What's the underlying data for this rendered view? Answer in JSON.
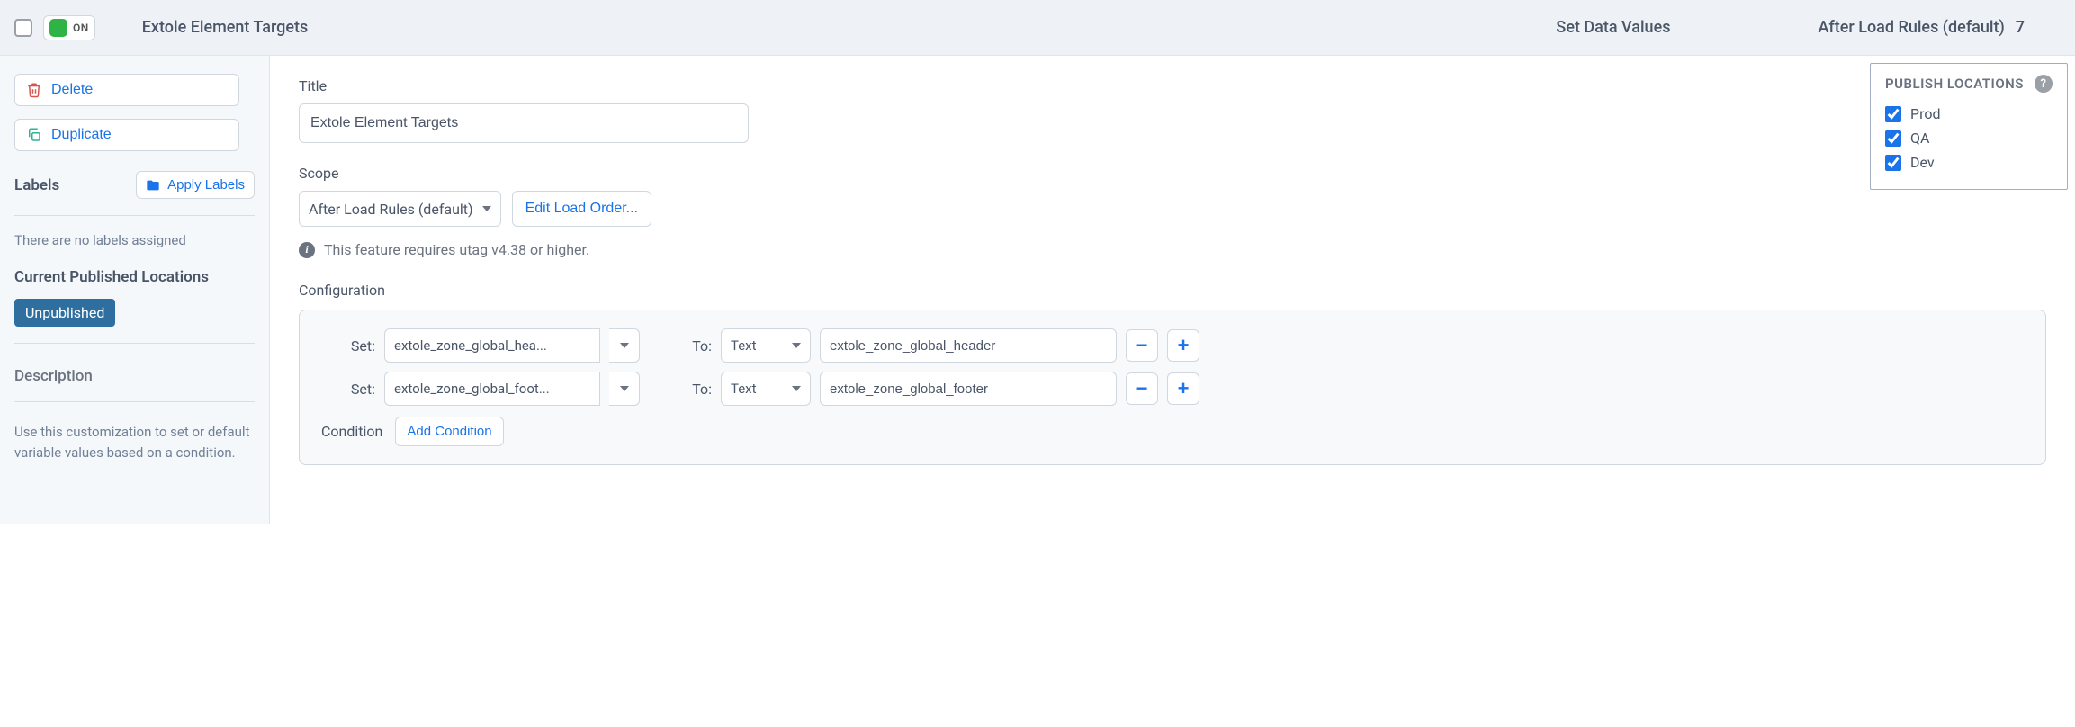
{
  "header": {
    "toggle_state": "ON",
    "title": "Extole Element Targets",
    "action": "Set Data Values",
    "rules": "After Load Rules (default)",
    "count": "7"
  },
  "sidebar": {
    "delete_label": "Delete",
    "duplicate_label": "Duplicate",
    "labels_title": "Labels",
    "apply_labels": "Apply Labels",
    "labels_empty": "There are no labels assigned",
    "published_title": "Current Published Locations",
    "published_status": "Unpublished",
    "description_title": "Description",
    "description_text": "Use this customization to set or default variable values based on a condition."
  },
  "main": {
    "title_label": "Title",
    "title_value": "Extole Element Targets",
    "scope_label": "Scope",
    "scope_value": "After Load Rules (default)",
    "edit_order": "Edit Load Order...",
    "info_text": "This feature requires utag v4.38 or higher.",
    "config_title": "Configuration",
    "rows": [
      {
        "set_label": "Set:",
        "variable": "extole_zone_global_hea...",
        "to_label": "To:",
        "type": "Text",
        "value": "extole_zone_global_header"
      },
      {
        "set_label": "Set:",
        "variable": "extole_zone_global_foot...",
        "to_label": "To:",
        "type": "Text",
        "value": "extole_zone_global_footer"
      }
    ],
    "condition_label": "Condition",
    "add_condition": "Add Condition"
  },
  "publish": {
    "title": "PUBLISH LOCATIONS",
    "options": [
      {
        "label": "Prod",
        "checked": true
      },
      {
        "label": "QA",
        "checked": true
      },
      {
        "label": "Dev",
        "checked": true
      }
    ]
  }
}
